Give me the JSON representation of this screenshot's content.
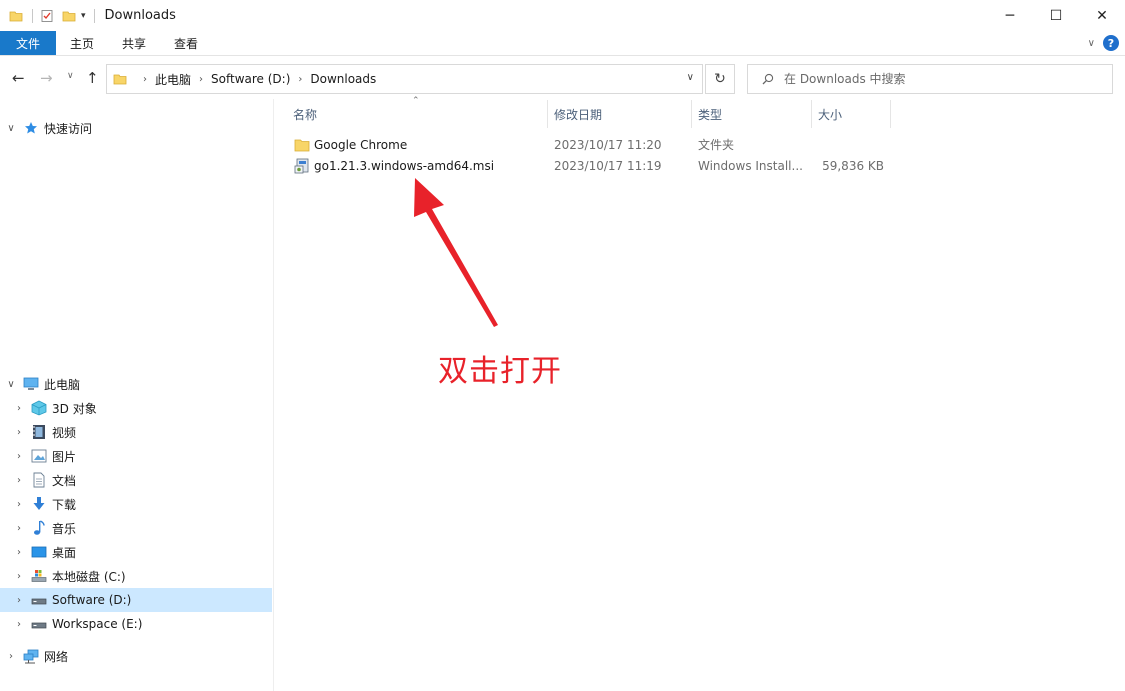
{
  "window": {
    "title": "Downloads",
    "minimize_glyph": "─",
    "maximize_glyph": "☐",
    "close_glyph": "✕"
  },
  "ribbon": {
    "tabs": [
      {
        "label": "文件"
      },
      {
        "label": "主页"
      },
      {
        "label": "共享"
      },
      {
        "label": "查看"
      }
    ],
    "help_glyph": "?"
  },
  "address": {
    "breadcrumbs": [
      "此电脑",
      "Software (D:)",
      "Downloads"
    ]
  },
  "search": {
    "placeholder": "在 Downloads 中搜索"
  },
  "nav": {
    "quick_access": "快速访问",
    "this_pc": "此电脑",
    "items": [
      {
        "label": "3D 对象",
        "icon": "3d-objects-icon"
      },
      {
        "label": "视频",
        "icon": "videos-icon"
      },
      {
        "label": "图片",
        "icon": "pictures-icon"
      },
      {
        "label": "文档",
        "icon": "documents-icon"
      },
      {
        "label": "下载",
        "icon": "downloads-icon"
      },
      {
        "label": "音乐",
        "icon": "music-icon"
      },
      {
        "label": "桌面",
        "icon": "desktop-icon"
      },
      {
        "label": "本地磁盘 (C:)",
        "icon": "drive-c-icon"
      },
      {
        "label": "Software (D:)",
        "icon": "drive-d-icon",
        "selected": true
      },
      {
        "label": "Workspace (E:)",
        "icon": "drive-e-icon"
      }
    ],
    "network": "网络"
  },
  "columns": {
    "name": "名称",
    "date": "修改日期",
    "type": "类型",
    "size": "大小"
  },
  "files": [
    {
      "name": "Google Chrome",
      "date": "2023/10/17 11:20",
      "type": "文件夹",
      "size": "",
      "icon": "folder-icon"
    },
    {
      "name": "go1.21.3.windows-amd64.msi",
      "date": "2023/10/17 11:19",
      "type": "Windows Install...",
      "size": "59,836 KB",
      "icon": "msi-installer-icon"
    }
  ],
  "annotation": {
    "text": "双击打开",
    "color": "#e8222a"
  },
  "colors": {
    "file_tab": "#1979ca",
    "selection": "#cce8ff",
    "folder": "#f8d568",
    "header_text": "#4c607a"
  }
}
